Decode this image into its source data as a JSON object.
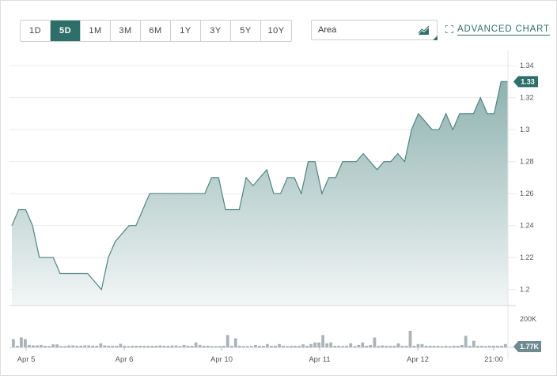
{
  "toolbar": {
    "ranges": [
      {
        "label": "1D",
        "active": false
      },
      {
        "label": "5D",
        "active": true
      },
      {
        "label": "1M",
        "active": false
      },
      {
        "label": "3M",
        "active": false
      },
      {
        "label": "6M",
        "active": false
      },
      {
        "label": "1Y",
        "active": false
      },
      {
        "label": "3Y",
        "active": false
      },
      {
        "label": "5Y",
        "active": false
      },
      {
        "label": "10Y",
        "active": false
      }
    ],
    "chart_type": "Area",
    "advanced_label": "ADVANCED CHART"
  },
  "colors": {
    "accent": "#2f6f6a",
    "line": "#4f8580",
    "fill_top": "#8fb3b0",
    "fill_bottom": "#f2f6f6",
    "volume_bar": "#aab3b8"
  },
  "chart_data": {
    "type": "area",
    "price": {
      "values": [
        1.24,
        1.25,
        1.25,
        1.24,
        1.22,
        1.22,
        1.22,
        1.21,
        1.21,
        1.21,
        1.21,
        1.21,
        1.205,
        1.2,
        1.22,
        1.23,
        1.235,
        1.24,
        1.24,
        1.25,
        1.26,
        1.26,
        1.26,
        1.26,
        1.26,
        1.26,
        1.26,
        1.26,
        1.26,
        1.27,
        1.27,
        1.25,
        1.25,
        1.25,
        1.27,
        1.265,
        1.27,
        1.275,
        1.26,
        1.26,
        1.27,
        1.27,
        1.26,
        1.28,
        1.28,
        1.26,
        1.27,
        1.27,
        1.28,
        1.28,
        1.28,
        1.285,
        1.28,
        1.275,
        1.28,
        1.28,
        1.285,
        1.28,
        1.3,
        1.31,
        1.305,
        1.3,
        1.3,
        1.31,
        1.3,
        1.31,
        1.31,
        1.31,
        1.32,
        1.31,
        1.31,
        1.33,
        1.33
      ],
      "y_ticks": [
        "1.34",
        "1.32",
        "1.3",
        "1.28",
        "1.26",
        "1.24",
        "1.22",
        "1.2"
      ],
      "ylim": [
        1.19,
        1.345
      ],
      "last_value": "1.33"
    },
    "volume": {
      "values": [
        50,
        10,
        60,
        50,
        15,
        12,
        12,
        15,
        10,
        8,
        18,
        18,
        8,
        8,
        12,
        12,
        10,
        10,
        12,
        12,
        10,
        10,
        25,
        12,
        10,
        10,
        10,
        22,
        10,
        8,
        10,
        10,
        10,
        10,
        10,
        10,
        10,
        12,
        10,
        10,
        12,
        12,
        8,
        15,
        10,
        10,
        30,
        15,
        10,
        10,
        8,
        8,
        8,
        10,
        75,
        10,
        55,
        10,
        8,
        8,
        8,
        15,
        10,
        10,
        20,
        10,
        10,
        20,
        10,
        8,
        10,
        10,
        10,
        18,
        10,
        20,
        30,
        30,
        75,
        25,
        30,
        10,
        10,
        8,
        10,
        25,
        8,
        15,
        30,
        10,
        15,
        60,
        10,
        12,
        10,
        10,
        10,
        25,
        10,
        10,
        100,
        10,
        20,
        20,
        10,
        10,
        10,
        10,
        8,
        10,
        8,
        10,
        10,
        15,
        70,
        10,
        40,
        10,
        10,
        8,
        10,
        10,
        10,
        10,
        20
      ],
      "top_label": "200K",
      "last_value": "1.77K",
      "ymax": 210
    },
    "x_labels": [
      "Apr 5",
      "Apr 6",
      "Apr 10",
      "Apr 11",
      "Apr 12",
      "21:00"
    ],
    "grid": true
  }
}
